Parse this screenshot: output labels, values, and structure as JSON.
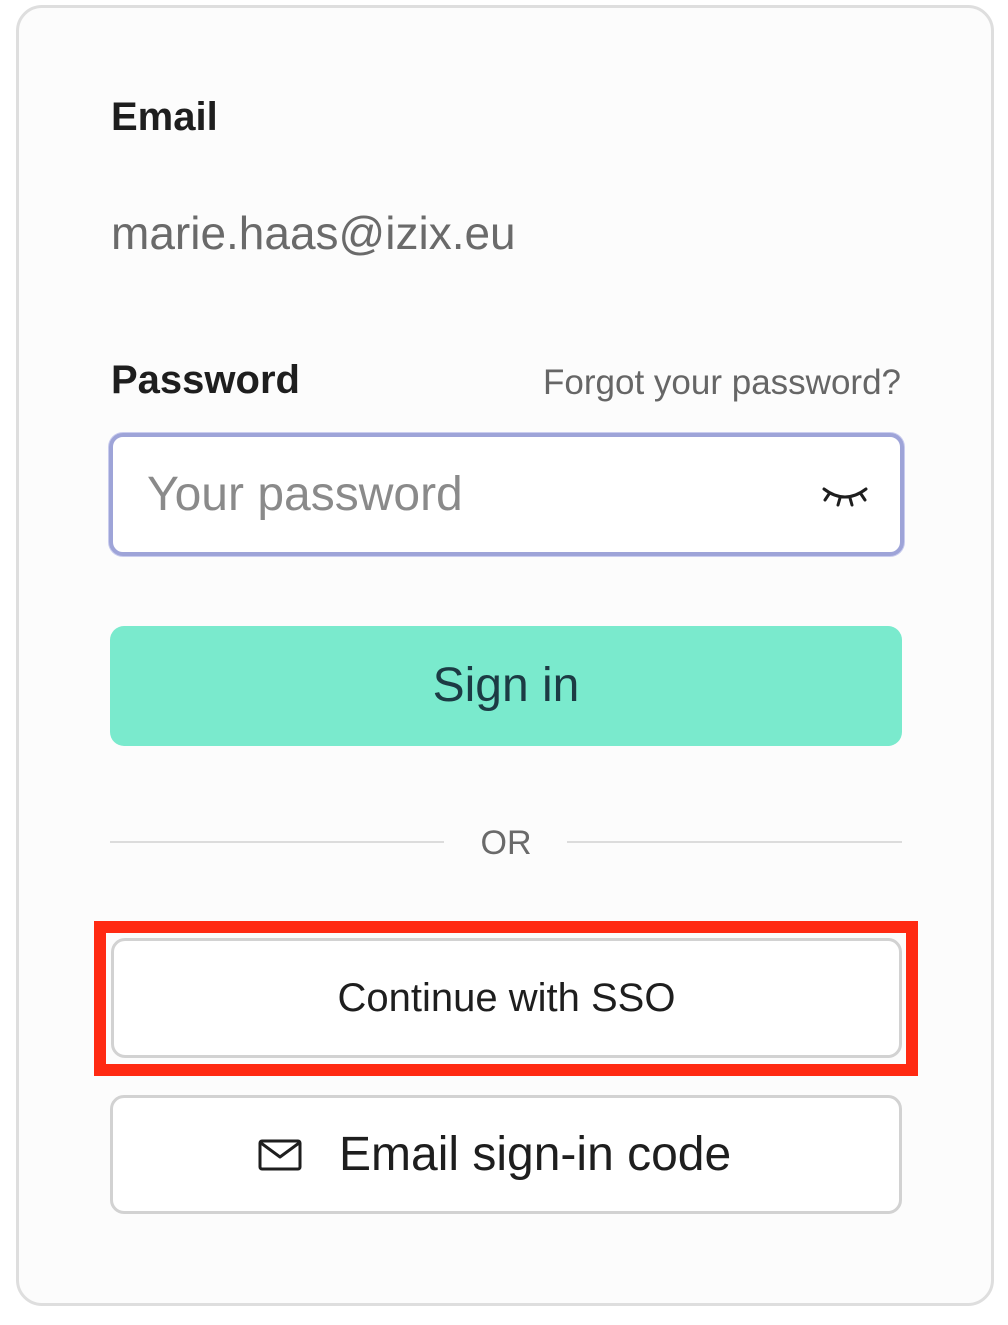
{
  "email": {
    "label": "Email",
    "value": "marie.haas@izix.eu"
  },
  "password": {
    "label": "Password",
    "forgot_link": "Forgot your password?",
    "placeholder": "Your password",
    "toggle_icon": "eye-closed-icon"
  },
  "actions": {
    "signin_label": "Sign in",
    "divider_text": "OR",
    "sso_label": "Continue with SSO",
    "email_code_label": "Email sign-in code",
    "email_code_icon": "mail-icon"
  },
  "colors": {
    "accent": "#7aeacd",
    "focus_border": "#9ea4d8",
    "highlight": "#ff2a12"
  }
}
